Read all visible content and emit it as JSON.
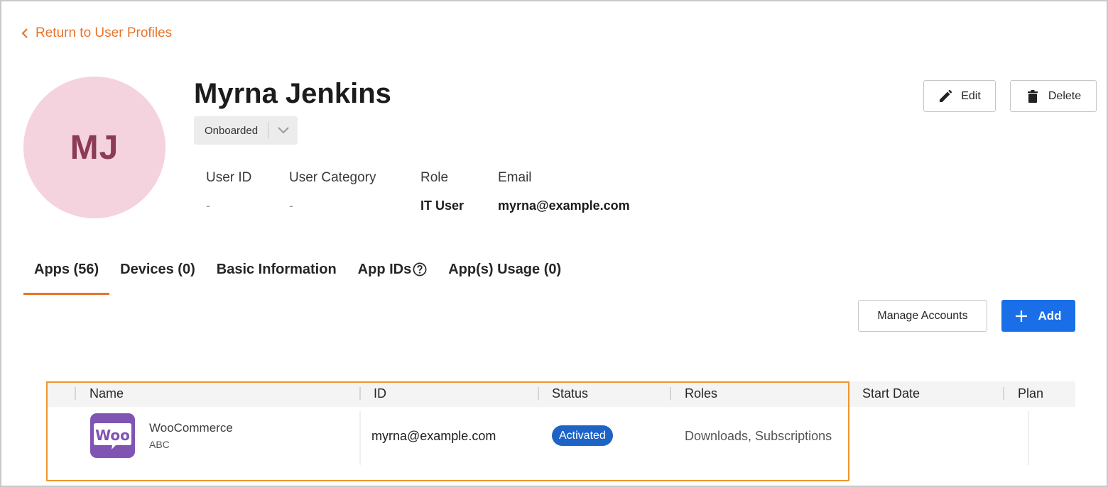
{
  "colors": {
    "accent": "#e8742a",
    "primary": "#1a6fe8",
    "avatar_bg": "#f5d3de",
    "avatar_text": "#8c3b57",
    "badge_bg": "#1e63c6",
    "app_logo_bg": "#7f54b3",
    "highlight": "#f0962e"
  },
  "nav": {
    "back_label": "Return to User Profiles",
    "back_icon": "chevron-left-icon"
  },
  "profile": {
    "initials": "MJ",
    "name": "Myrna Jenkins",
    "status": {
      "selected": "Onboarded",
      "icon": "chevron-down-icon"
    },
    "fields": [
      {
        "label": "User ID",
        "value": "-"
      },
      {
        "label": "User Category",
        "value": "-"
      },
      {
        "label": "Role",
        "value": "IT User"
      },
      {
        "label": "Email",
        "value": "myrna@example.com"
      }
    ]
  },
  "actions": {
    "edit_label": "Edit",
    "edit_icon": "pencil-icon",
    "delete_label": "Delete",
    "delete_icon": "trash-icon"
  },
  "tabs": [
    {
      "label": "Apps (56)",
      "active": true
    },
    {
      "label": "Devices (0)",
      "active": false
    },
    {
      "label": "Basic Information",
      "active": false
    },
    {
      "label": "App IDs",
      "active": false,
      "icon": "help-circle-icon"
    },
    {
      "label": "App(s) Usage (0)",
      "active": false
    }
  ],
  "toolbar": {
    "manage_label": "Manage Accounts",
    "add_label": "Add",
    "add_icon": "plus-icon"
  },
  "table": {
    "columns": [
      "Name",
      "ID",
      "Status",
      "Roles",
      "Start Date",
      "Plan"
    ],
    "rows": [
      {
        "logo_text": "Woo",
        "name": "WooCommerce",
        "subtitle": "ABC",
        "id": "myrna@example.com",
        "status": "Activated",
        "roles": "Downloads, Subscriptions",
        "start_date": "",
        "plan": ""
      }
    ]
  }
}
